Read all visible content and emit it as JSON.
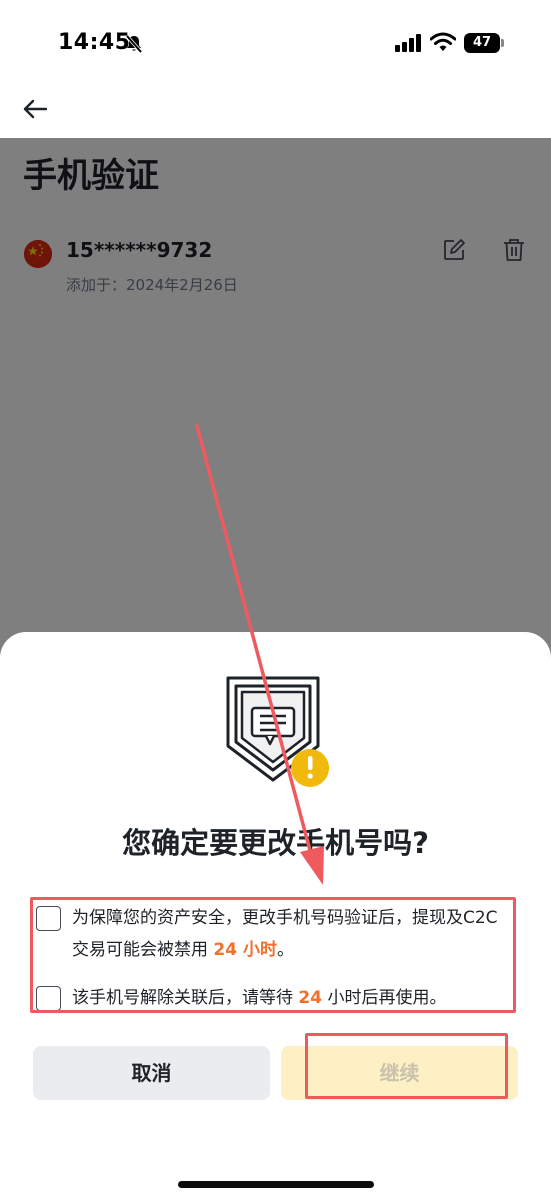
{
  "status_bar": {
    "time": "14:45",
    "battery": "47",
    "icons": [
      "bell-slash-icon",
      "signal-icon",
      "wifi-icon",
      "battery-icon"
    ]
  },
  "header": {
    "back_icon": "arrow-left-icon"
  },
  "page": {
    "title": "手机验证",
    "phone": {
      "flag_icon": "china-flag-icon",
      "number": "15******9732",
      "added_date": "添加于：2024年2月26日",
      "edit_icon": "edit-icon",
      "delete_icon": "trash-icon"
    }
  },
  "dialog": {
    "illustration": "shield-warning-icon",
    "title": "您确定要更改手机号吗?",
    "checkboxes": [
      {
        "checked": false,
        "text_before": "为保障您的资产安全，更改手机号码验证后，提现及C2C 交易可能会被禁用 ",
        "highlight": "24 小时",
        "text_after": "。"
      },
      {
        "checked": false,
        "text_before": "该手机号解除关联后，请等待 ",
        "highlight": "24",
        "text_after": " 小时后再使用。"
      }
    ],
    "cancel_label": "取消",
    "continue_label": "继续"
  },
  "colors": {
    "highlight": "#f0712d",
    "annotation": "#ef5a5e",
    "continue_bg": "#fdf0c4",
    "warning_badge": "#f0b90b"
  }
}
